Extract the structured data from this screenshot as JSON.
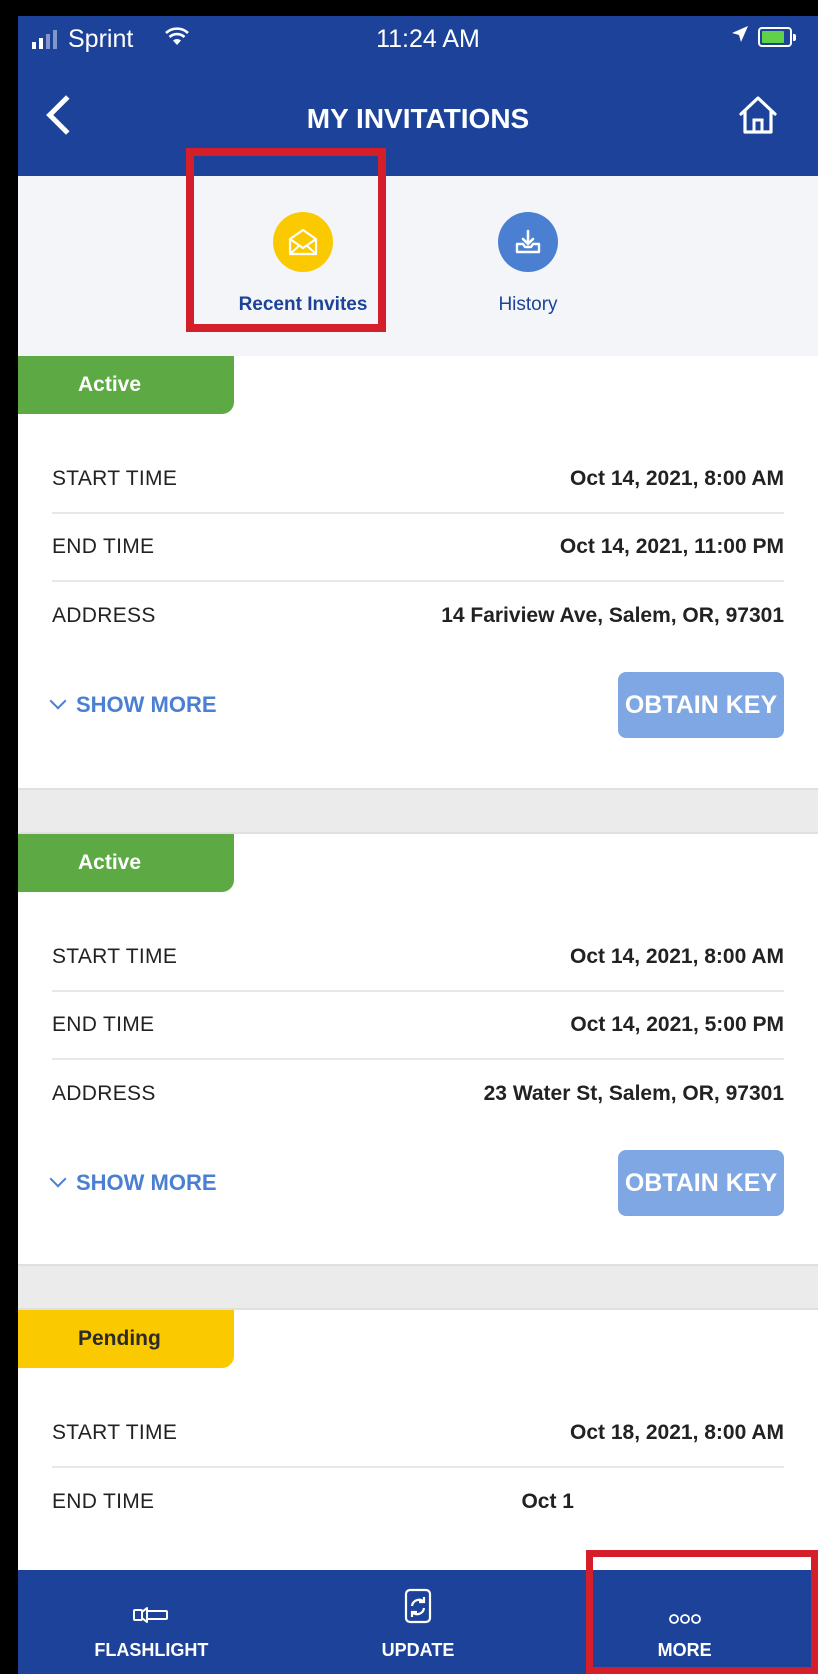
{
  "status_bar": {
    "carrier": "Sprint",
    "time": "11:24 AM"
  },
  "nav": {
    "title": "MY INVITATIONS"
  },
  "tabs": [
    {
      "label": "Recent Invites",
      "icon": "envelope-icon",
      "selected": true
    },
    {
      "label": "History",
      "icon": "download-tray-icon",
      "selected": false
    }
  ],
  "invitations": [
    {
      "status": "Active",
      "start_label": "START TIME",
      "start_value": "Oct 14, 2021, 8:00 AM",
      "end_label": "END TIME",
      "end_value": "Oct 14, 2021, 11:00 PM",
      "address_label": "ADDRESS",
      "address_value": "14 Fariview Ave, Salem, OR, 97301",
      "show_more": "SHOW MORE",
      "obtain_key": "OBTAIN KEY"
    },
    {
      "status": "Active",
      "start_label": "START TIME",
      "start_value": "Oct 14, 2021, 8:00 AM",
      "end_label": "END TIME",
      "end_value": "Oct 14, 2021, 5:00 PM",
      "address_label": "ADDRESS",
      "address_value": "23 Water St, Salem, OR, 97301",
      "show_more": "SHOW MORE",
      "obtain_key": "OBTAIN KEY"
    },
    {
      "status": "Pending",
      "start_label": "START TIME",
      "start_value": "Oct 18, 2021, 8:00 AM",
      "end_label": "END TIME",
      "end_value": "Oct 1"
    }
  ],
  "tab_bar": [
    {
      "label": "FLASHLIGHT",
      "icon": "flashlight-icon"
    },
    {
      "label": "UPDATE",
      "icon": "update-icon"
    },
    {
      "label": "MORE",
      "icon": "more-dots-icon"
    }
  ],
  "colors": {
    "brand_blue": "#1c4399",
    "active_green": "#5daa45",
    "pending_yellow": "#fbc900",
    "highlight_red": "#d41f2b"
  }
}
